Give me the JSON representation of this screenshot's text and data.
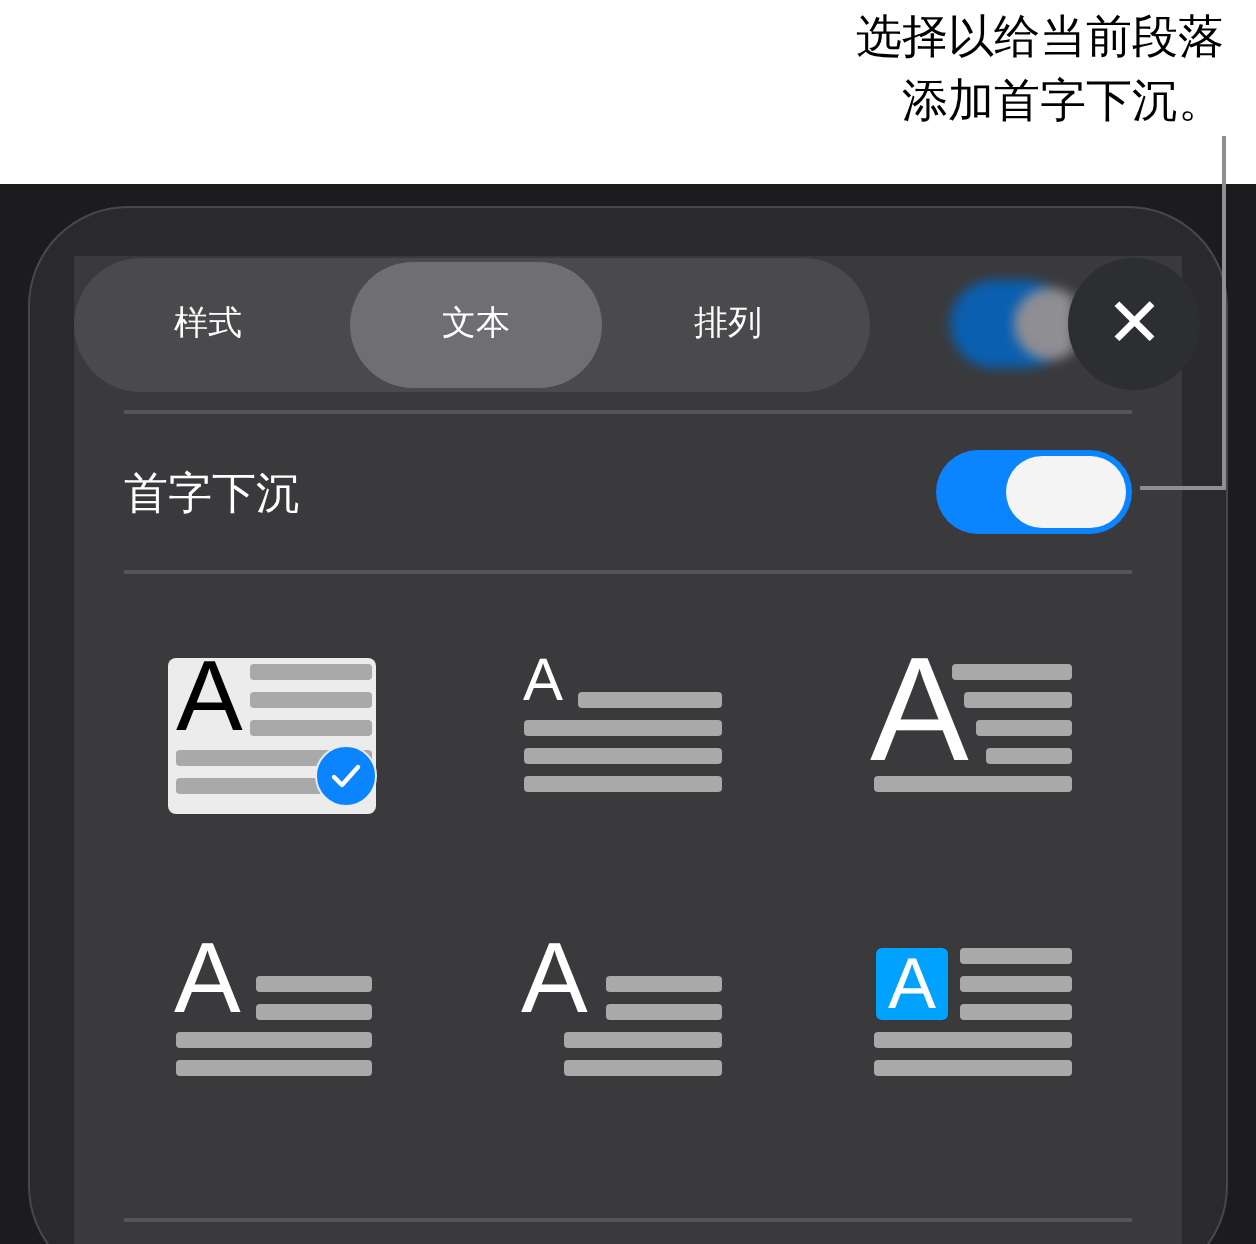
{
  "callout": {
    "lines": [
      "选择以给当前段落",
      "添加首字下沉。"
    ]
  },
  "tabs": [
    {
      "label": "样式",
      "selected": false
    },
    {
      "label": "文本",
      "selected": true
    },
    {
      "label": "排列",
      "selected": false
    }
  ],
  "close_button": {
    "label": "✕"
  },
  "drop_cap_row": {
    "label": "首字下沉",
    "on": true
  },
  "styles": [
    {
      "kind": "inset",
      "letter": "A",
      "selected": true
    },
    {
      "kind": "raised",
      "letter": "A",
      "selected": false
    },
    {
      "kind": "large",
      "letter": "A",
      "selected": false
    },
    {
      "kind": "drop",
      "letter": "A",
      "selected": false
    },
    {
      "kind": "hanging",
      "letter": "A",
      "selected": false
    },
    {
      "kind": "boxed",
      "letter": "A",
      "selected": false
    }
  ]
}
